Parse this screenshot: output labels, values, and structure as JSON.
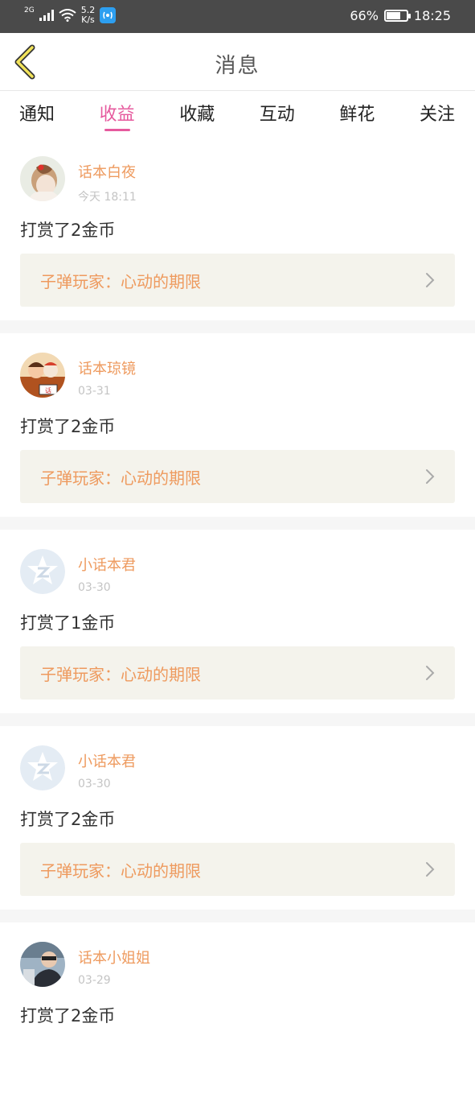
{
  "status_bar": {
    "network": "2G",
    "speed_value": "5.2",
    "speed_unit": "K/s",
    "battery_percent": "66%",
    "battery_level": 0.66,
    "time": "18:25",
    "icons": [
      "signal-icon",
      "wifi-icon",
      "app-notification-icon",
      "battery-icon"
    ]
  },
  "header": {
    "title": "消息",
    "back_icon": "chevron-left-icon"
  },
  "tabs": [
    {
      "label": "通知",
      "active": false
    },
    {
      "label": "收益",
      "active": true
    },
    {
      "label": "收藏",
      "active": false
    },
    {
      "label": "互动",
      "active": false
    },
    {
      "label": "鲜花",
      "active": false
    },
    {
      "label": "关注",
      "active": false
    }
  ],
  "colors": {
    "accent": "#e65a9e",
    "username": "#ee9a5e",
    "link_bg": "#f4f3ec"
  },
  "items": [
    {
      "username": "话本白夜",
      "time": "今天 18:11",
      "message": "打赏了2金币",
      "work": "子弹玩家：心动的期限",
      "avatar": "girl-photo"
    },
    {
      "username": "话本琼镜",
      "time": "03-31",
      "message": "打赏了2金币",
      "work": "子弹玩家：心动的期限",
      "avatar": "cartoon-illustration"
    },
    {
      "username": "小话本君",
      "time": "03-30",
      "message": "打赏了1金币",
      "work": "子弹玩家：心动的期限",
      "avatar": "default-star-logo"
    },
    {
      "username": "小话本君",
      "time": "03-30",
      "message": "打赏了2金币",
      "work": "子弹玩家：心动的期限",
      "avatar": "default-star-logo"
    },
    {
      "username": "话本小姐姐",
      "time": "03-29",
      "message": "打赏了2金币",
      "work": "",
      "avatar": "man-photo"
    }
  ]
}
